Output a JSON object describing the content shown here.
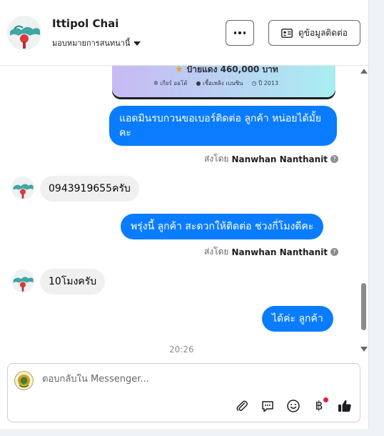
{
  "header": {
    "name": "Ittipol Chai",
    "assign_label": "มอบหมายการสนทนานี้",
    "contact_button": "ดูข้อมูลติดต่อ"
  },
  "card": {
    "line1": "ป้ายแดง 460,000 บาท",
    "specs": [
      "เกียร์ ออโต้",
      "เชื้อเพลิง เบนซิน",
      "ปี 2013"
    ]
  },
  "messages": [
    {
      "side": "out",
      "text": "แอดมินรบกวนขอเบอร์ติดต่อ ลูกค้า  หน่อยได้มั้ยคะ"
    },
    {
      "side": "in",
      "text": "0943919655ครับ"
    },
    {
      "side": "out",
      "text": "พรุ่งนี้ ลูกค้า  สะดวกให้ติดต่อ ช่วงกี่โมงดีคะ"
    },
    {
      "side": "in",
      "text": "10โมงครับ"
    },
    {
      "side": "out",
      "text": "ได้ค่ะ  ลูกค้า"
    }
  ],
  "sent_by": {
    "prefix": "ส่งโดย",
    "agent": "Nanwhan Nanthanit",
    "help": "?"
  },
  "timestamp": "20:26",
  "composer": {
    "placeholder": "ตอบกลับใน Messenger...",
    "tools": [
      "paperclip-icon",
      "saved-reply-icon",
      "emoji-icon",
      "baht-payment-icon",
      "thumbs-up-icon"
    ]
  },
  "colors": {
    "outgoing": "#0a7cff",
    "incoming": "#f0f0f0",
    "badge": "#e41e3f"
  }
}
